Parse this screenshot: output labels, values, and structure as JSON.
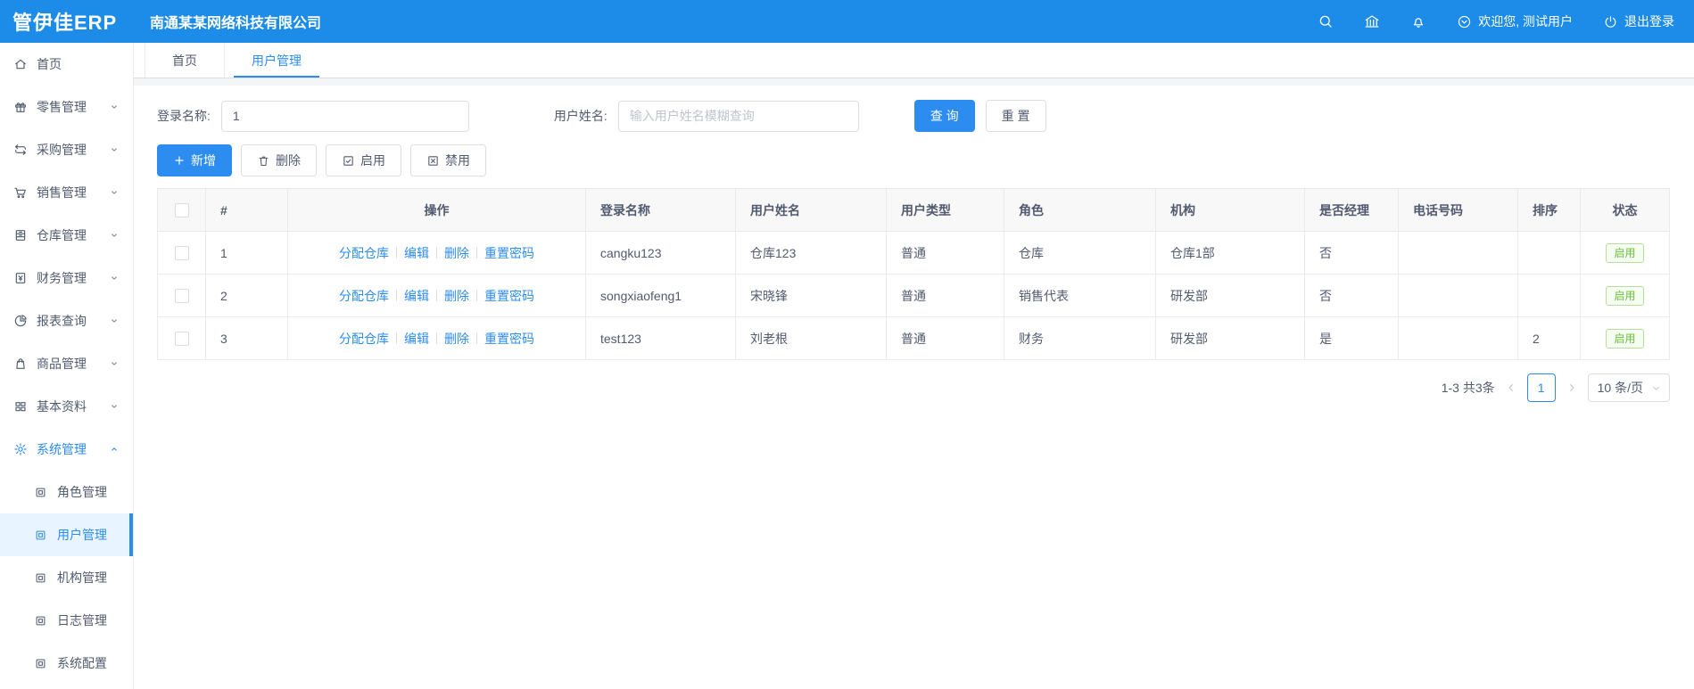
{
  "header": {
    "logo": "管伊佳ERP",
    "company": "南通某某网络科技有限公司",
    "welcome": "欢迎您, 测试用户",
    "logout": "退出登录"
  },
  "sidebar": {
    "items": [
      {
        "label": "首页"
      },
      {
        "label": "零售管理"
      },
      {
        "label": "采购管理"
      },
      {
        "label": "销售管理"
      },
      {
        "label": "仓库管理"
      },
      {
        "label": "财务管理"
      },
      {
        "label": "报表查询"
      },
      {
        "label": "商品管理"
      },
      {
        "label": "基本资料"
      },
      {
        "label": "系统管理"
      }
    ],
    "subitems": [
      {
        "label": "角色管理"
      },
      {
        "label": "用户管理"
      },
      {
        "label": "机构管理"
      },
      {
        "label": "日志管理"
      },
      {
        "label": "系统配置"
      }
    ]
  },
  "tabs": [
    {
      "label": "首页"
    },
    {
      "label": "用户管理"
    }
  ],
  "filters": {
    "login_name_label": "登录名称:",
    "login_name_value": "1",
    "user_name_label": "用户姓名:",
    "user_name_placeholder": "输入用户姓名模糊查询",
    "search_label": "查 询",
    "reset_label": "重 置"
  },
  "toolbar": {
    "add_label": "新增",
    "delete_label": "删除",
    "enable_label": "启用",
    "disable_label": "禁用"
  },
  "table": {
    "columns": [
      "#",
      "操作",
      "登录名称",
      "用户姓名",
      "用户类型",
      "角色",
      "机构",
      "是否经理",
      "电话号码",
      "排序",
      "状态"
    ],
    "action_links": [
      "分配仓库",
      "编辑",
      "删除",
      "重置密码"
    ],
    "rows": [
      {
        "index": "1",
        "login": "cangku123",
        "name": "仓库123",
        "type": "普通",
        "role": "仓库",
        "org": "仓库1部",
        "manager": "否",
        "phone": "",
        "sort": "",
        "status": "启用"
      },
      {
        "index": "2",
        "login": "songxiaofeng1",
        "name": "宋晓锋",
        "type": "普通",
        "role": "销售代表",
        "org": "研发部",
        "manager": "否",
        "phone": "",
        "sort": "",
        "status": "启用"
      },
      {
        "index": "3",
        "login": "test123",
        "name": "刘老根",
        "type": "普通",
        "role": "财务",
        "org": "研发部",
        "manager": "是",
        "phone": "",
        "sort": "2",
        "status": "启用"
      }
    ]
  },
  "pagination": {
    "total_text": "1-3 共3条",
    "current_page": "1",
    "page_size": "10 条/页"
  },
  "colors": {
    "primary": "#2d8cf0",
    "header_bg": "#1d8ce8",
    "success_text": "#67c23a",
    "success_border": "#b3e19d",
    "table_header_bg": "#f8f8f9",
    "border": "#e8eaec"
  }
}
